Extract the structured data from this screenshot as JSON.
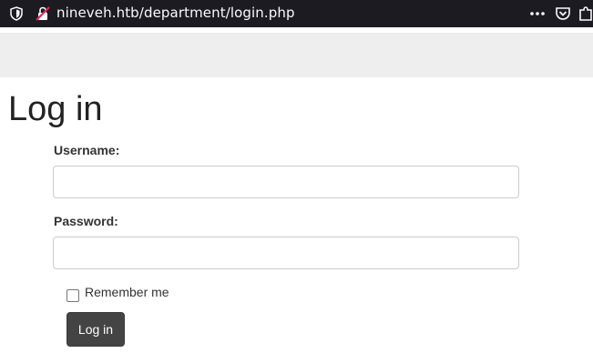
{
  "browser": {
    "url": "nineveh.htb/department/login.php",
    "icons": {
      "site_info": "shield-icon",
      "connection": "insecure-lock-icon",
      "page_actions": "more-icon",
      "pocket": "pocket-icon",
      "extensions": "extension-icon"
    }
  },
  "page": {
    "title": "Log in",
    "username_label": "Username:",
    "username_value": "",
    "password_label": "Password:",
    "password_value": "",
    "remember_label": "Remember me",
    "remember_checked": false,
    "login_button": "Log in"
  },
  "colors": {
    "urlbar_bg": "#1c1b22",
    "navbar_bg": "#eeeeee",
    "button_bg": "#444444",
    "insecure_red": "#e22850"
  }
}
